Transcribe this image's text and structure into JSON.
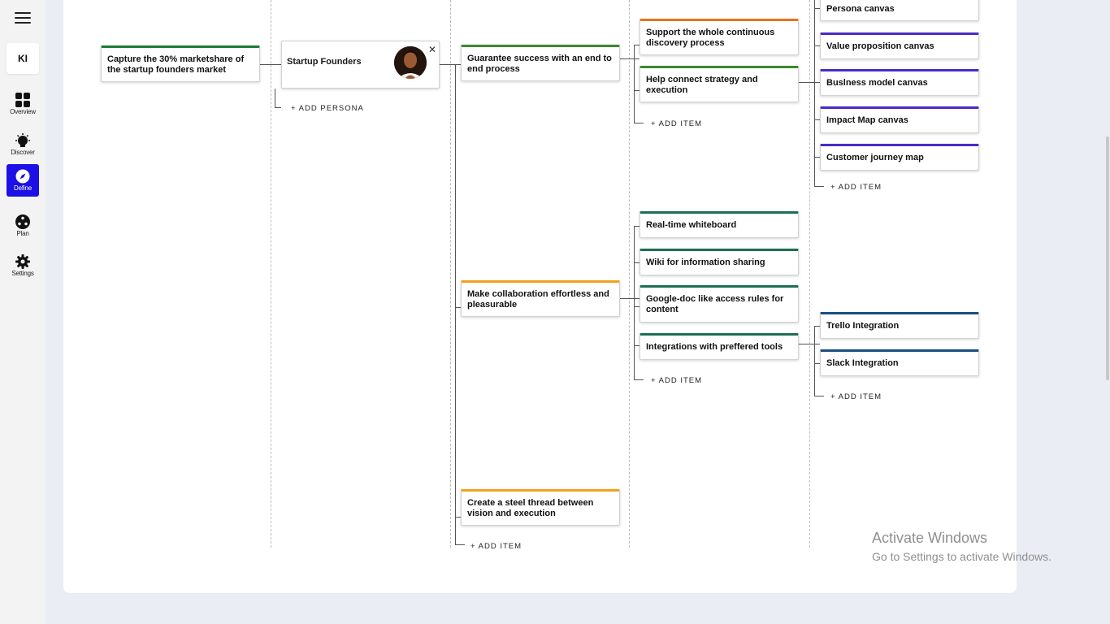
{
  "sidebar": {
    "workspace_initials": "KI",
    "items": [
      {
        "label": "Overview",
        "icon": "grid-icon"
      },
      {
        "label": "Discover",
        "icon": "lightbulb-icon"
      },
      {
        "label": "Define",
        "icon": "compass-icon",
        "active": true
      },
      {
        "label": "Plan",
        "icon": "nodes-icon"
      },
      {
        "label": "Settings",
        "icon": "gear-icon"
      }
    ]
  },
  "board": {
    "goal": "Capture the 30% marketshare of the startup founders market",
    "persona": {
      "name": "Startup Founders",
      "add_label": "+ ADD PERSONA"
    },
    "outcomes": [
      "Guarantee success with an end to end  process",
      "Make collaboration effortless and pleasurable",
      "Create a steel thread between vision and execution"
    ],
    "outcomes_add_label": "+ ADD ITEM",
    "features_a": [
      "Support the whole continuous discovery process",
      "Help connect strategy and execution"
    ],
    "features_a_add_label": "+ ADD ITEM",
    "features_b": [
      "Real-time whiteboard",
      "Wiki for information sharing",
      "Google-doc like access rules for content",
      "Integrations with preffered tools"
    ],
    "features_b_add_label": "+ ADD ITEM",
    "sub_a": [
      "Persona canvas",
      "Value proposition canvas",
      "Buslness model canvas",
      "Impact Map canvas",
      "Customer journey map"
    ],
    "sub_a_add_label": "+ ADD ITEM",
    "sub_b": [
      "Trello Integration",
      "Slack Integration"
    ],
    "sub_b_add_label": "+ ADD ITEM"
  },
  "colors": {
    "goal": "#1f7a3a",
    "outcome_1": "#3b8a2e",
    "outcome_2": "#f0a21c",
    "outcome_3": "#f0a21c",
    "support_discovery": "#e8731c",
    "connect_strategy": "#3b8a2e",
    "collab_features": "#1c6e55",
    "canvas_items": "#4b2bc7",
    "integrations": "#1a4f80",
    "active_nav": "#1d10e6"
  },
  "watermark": {
    "title": "Activate Windows",
    "subtitle": "Go to Settings to activate Windows."
  }
}
